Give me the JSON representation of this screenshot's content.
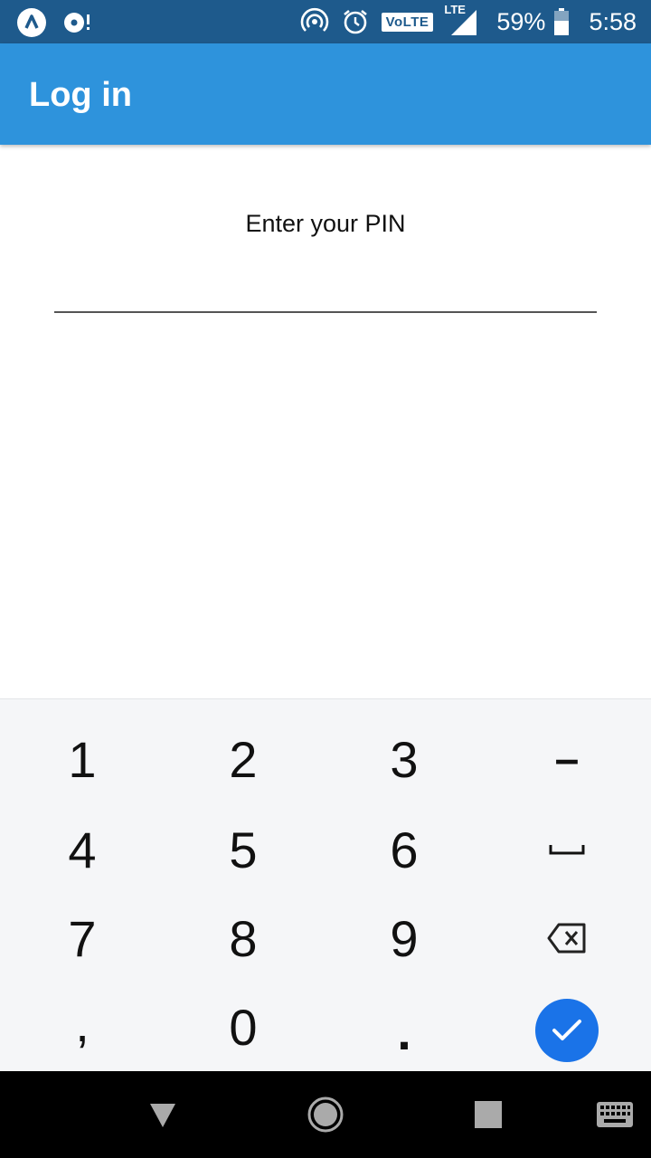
{
  "status_bar": {
    "left_icons": [
      "app-a-icon",
      "disc-alert-icon"
    ],
    "right_icons": [
      "hotspot-icon",
      "alarm-icon",
      "volte-badge",
      "lte-signal-icon",
      "battery-icon"
    ],
    "volte": "VoLTE",
    "lte": "LTE",
    "battery": "59%",
    "time": "5:58"
  },
  "appbar": {
    "title": "Log in"
  },
  "login": {
    "prompt": "Enter your PIN",
    "pin_value": "",
    "pin_placeholder": ""
  },
  "keypad": {
    "keys": [
      "1",
      "2",
      "3",
      "–",
      "4",
      "5",
      "6",
      "␣",
      "7",
      "8",
      "9",
      "⌫",
      ",",
      "0",
      ".",
      "✓"
    ],
    "minus": "–",
    "space": "space-icon",
    "backspace": "backspace-icon",
    "enter": "check-icon",
    "enter_color": "#1a73e8"
  },
  "navbar": {
    "buttons": [
      "back-icon",
      "home-icon",
      "recents-icon",
      "keyboard-icon"
    ]
  },
  "colors": {
    "status_bar": "#1e5a8c",
    "appbar": "#2e93dc",
    "keypad_bg": "#f5f6f8"
  }
}
